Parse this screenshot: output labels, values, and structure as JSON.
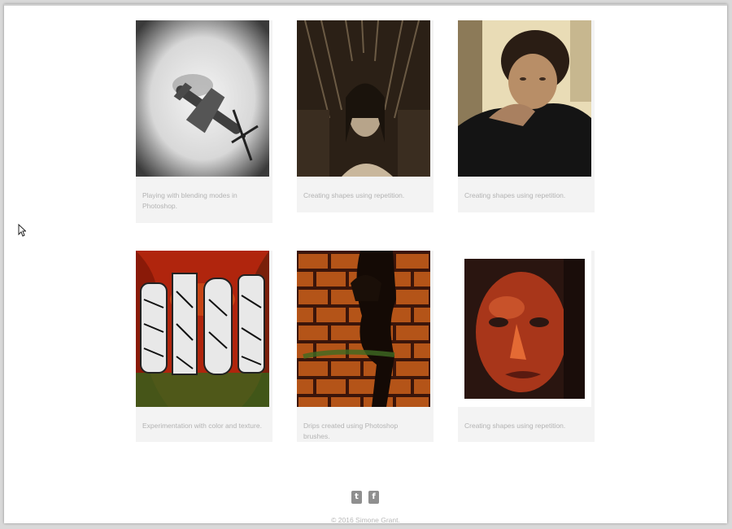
{
  "gallery": {
    "items": [
      {
        "caption": "Playing with blending modes in Photoshop.",
        "image": "spitfire-plane-bw"
      },
      {
        "caption": "Creating shapes using repetition.",
        "image": "man-throne-sepia"
      },
      {
        "caption": "Creating shapes using repetition.",
        "image": "child-portrait"
      },
      {
        "caption": "Experimentation with color and texture.",
        "image": "stop-lettering-art"
      },
      {
        "caption": "Drips created using Photoshop brushes.",
        "image": "brick-wall-silhouette"
      },
      {
        "caption": "Creating shapes using repetition.",
        "image": "red-face-painting"
      }
    ]
  },
  "footer": {
    "social": [
      {
        "icon": "twitter-icon",
        "glyph": "t"
      },
      {
        "icon": "facebook-icon",
        "glyph": "f"
      }
    ],
    "copyright": "© 2016 Simone Grant."
  }
}
